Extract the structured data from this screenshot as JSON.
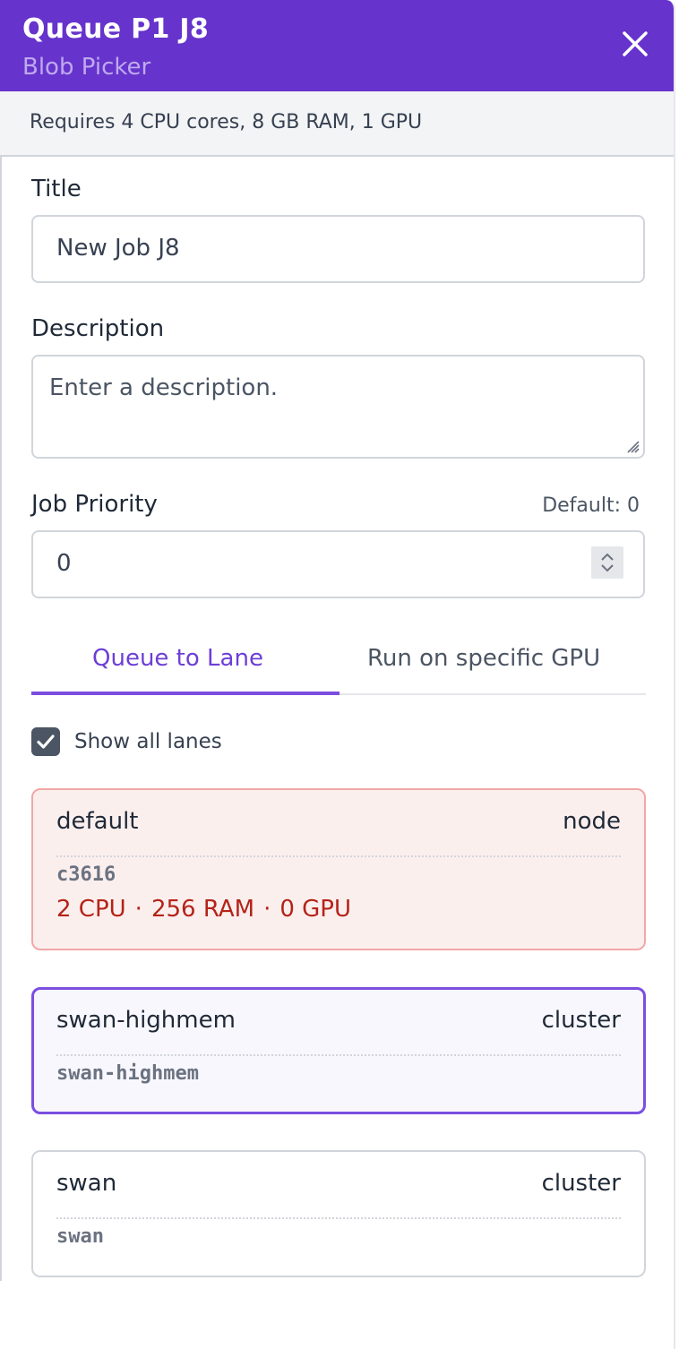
{
  "header": {
    "title": "Queue P1 J8",
    "subtitle": "Blob Picker",
    "close_icon": "close-icon"
  },
  "requirements": {
    "text": "Requires 4 CPU cores, 8 GB RAM, 1 GPU"
  },
  "form": {
    "title_label": "Title",
    "title_value": "New Job J8",
    "description_label": "Description",
    "description_placeholder": "Enter a description.",
    "priority_label": "Job Priority",
    "priority_default": "Default: 0",
    "priority_value": "0"
  },
  "tabs": [
    {
      "label": "Queue to Lane",
      "active": true
    },
    {
      "label": "Run on specific GPU",
      "active": false
    }
  ],
  "show_all_lanes": {
    "label": "Show all lanes",
    "checked": true
  },
  "lanes": [
    {
      "name": "default",
      "type": "node",
      "id": "c3616",
      "resources": {
        "cpu": "2 CPU",
        "ram": "256 RAM",
        "gpu": "0 GPU"
      },
      "state": "insufficient"
    },
    {
      "name": "swan-highmem",
      "type": "cluster",
      "id": "swan-highmem",
      "state": "selected"
    },
    {
      "name": "swan",
      "type": "cluster",
      "id": "swan",
      "state": "normal"
    }
  ],
  "colors": {
    "header_bg": "#6633cc",
    "accent": "#7b4ee0",
    "error_text": "#b42318",
    "error_bg": "#fbefee"
  }
}
